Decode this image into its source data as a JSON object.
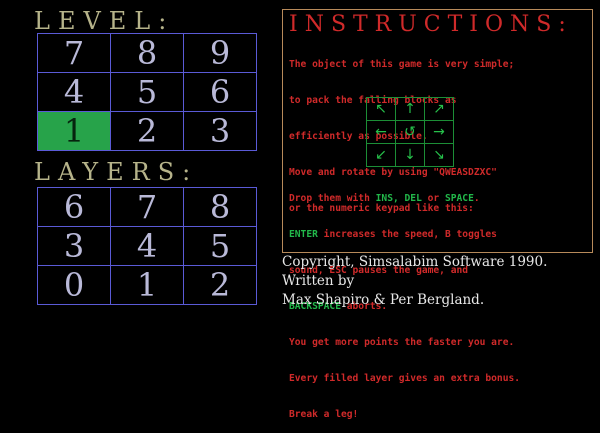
{
  "level": {
    "heading": "LEVEL:",
    "rows": [
      [
        "7",
        "8",
        "9"
      ],
      [
        "4",
        "5",
        "6"
      ],
      [
        "1",
        "2",
        "3"
      ]
    ],
    "selected": "1"
  },
  "layers": {
    "heading": "LAYERS:",
    "rows": [
      [
        "6",
        "7",
        "8"
      ],
      [
        "3",
        "4",
        "5"
      ],
      [
        "0",
        "1",
        "2"
      ]
    ]
  },
  "instructions": {
    "title": "INSTRUCTIONS:",
    "line1": "The object of this game is very simple;",
    "line2": "to pack the falling blocks as",
    "line3": "efficiently as possible.",
    "line4": "Move and rotate by using \"QWEASDZXC\"",
    "line5": "or the numeric keypad like this:",
    "keypad": [
      [
        "↖",
        "↑",
        "↗"
      ],
      [
        "←",
        "↺",
        "→"
      ],
      [
        "↙",
        "↓",
        "↘"
      ]
    ],
    "keypad_icons": [
      [
        "arrow-up-left-icon",
        "arrow-up-icon",
        "arrow-up-right-icon"
      ],
      [
        "arrow-left-icon",
        "rotate-icon",
        "arrow-right-icon"
      ],
      [
        "arrow-down-left-icon",
        "arrow-down-icon",
        "arrow-down-right-icon"
      ]
    ],
    "drop_pre": "Drop them with ",
    "drop_keys": "INS, DEL",
    "drop_mid": " or ",
    "drop_space": "SPACE",
    "drop_end": ".",
    "enter_key": "ENTER",
    "enter_text": " increases the speed, B toggles",
    "sound_line": "sound, ESC pauses the game, and",
    "backspace_key": "BACKSPACE",
    "backspace_text": " aborts.",
    "points_line": "You get more points the faster you are.",
    "bonus_line": "Every filled layer gives an extra bonus.",
    "leg_line": "Break a leg!"
  },
  "credits": {
    "line1": "Copyright, Simsalabim Software 1990.",
    "line2": "Written by",
    "line3": "Max Shapiro & Per Bergland."
  },
  "colors": {
    "accent_red": "#d02a2a",
    "accent_green": "#22b84a",
    "grid_blue": "#5a5ad6",
    "heading_khaki": "#b6b38a"
  }
}
